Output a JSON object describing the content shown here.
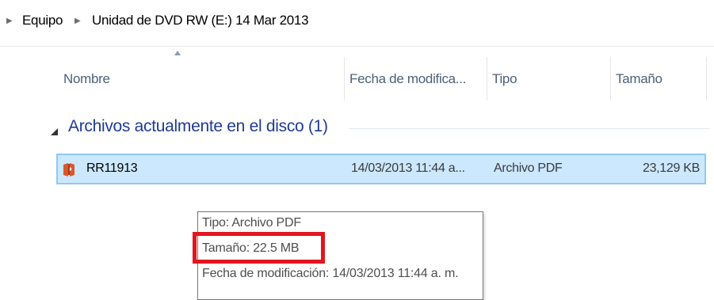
{
  "breadcrumb": {
    "items": [
      "Equipo",
      "Unidad de DVD RW (E:) 14 Mar 2013"
    ],
    "separator_icon": "chevron-right-icon"
  },
  "columns": {
    "name": "Nombre",
    "date": "Fecha de modifica...",
    "type": "Tipo",
    "size": "Tamaño",
    "sort_icon": "sort-ascending-icon"
  },
  "group": {
    "title": "Archivos actualmente en el disco (1)",
    "expand_icon": "collapse-triangle-icon"
  },
  "files": [
    {
      "name": "RR11913",
      "date": "14/03/2013 11:44 a...",
      "type": "Archivo PDF",
      "size": "23,129 KB",
      "icon": "pdf-icon",
      "selected": true
    }
  ],
  "tooltip": {
    "type_line": "Tipo: Archivo PDF",
    "size_line": "Tamaño: 22.5 MB",
    "date_line": "Fecha de modificación: 14/03/2013 11:44 a. m."
  },
  "colors": {
    "selection_bg": "#cce8ff",
    "selection_border": "#90c8f4",
    "group_title": "#1e3b96",
    "highlight": "#e2161e",
    "pdf_icon": "#d9572b"
  }
}
